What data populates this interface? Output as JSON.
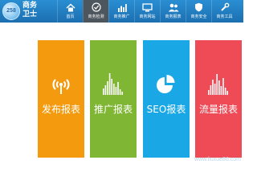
{
  "brand": {
    "logo_text": "258",
    "name_line1": "商务",
    "name_line2": "卫士",
    "logo_icon": "brand-logo-icon"
  },
  "nav": {
    "items": [
      {
        "label": "首页",
        "icon": "home-icon",
        "active": false
      },
      {
        "label": "商务检测",
        "icon": "globe-check-icon",
        "active": true
      },
      {
        "label": "商务推广",
        "icon": "bar-chart-icon",
        "active": false
      },
      {
        "label": "商务网站",
        "icon": "monitor-icon",
        "active": false
      },
      {
        "label": "商务报表",
        "icon": "users-icon",
        "active": false
      },
      {
        "label": "商务安全",
        "icon": "shield-icon",
        "active": false
      },
      {
        "label": "商务工具",
        "icon": "tools-icon",
        "active": false
      }
    ]
  },
  "cards": [
    {
      "label": "发布报表",
      "icon": "broadcast-icon",
      "color": "#f39a0e"
    },
    {
      "label": "推广报表",
      "icon": "bar-chart-icon",
      "color": "#7fb734"
    },
    {
      "label": "SEO报表",
      "icon": "pie-chart-icon",
      "color": "#1aa7e6"
    },
    {
      "label": "流量报表",
      "icon": "bar-chart-icon",
      "color": "#ee4b57"
    }
  ],
  "colors": {
    "topbar": "#2280c4",
    "active_tab": "#4d555d"
  },
  "watermark": "www.liuxue86.com"
}
